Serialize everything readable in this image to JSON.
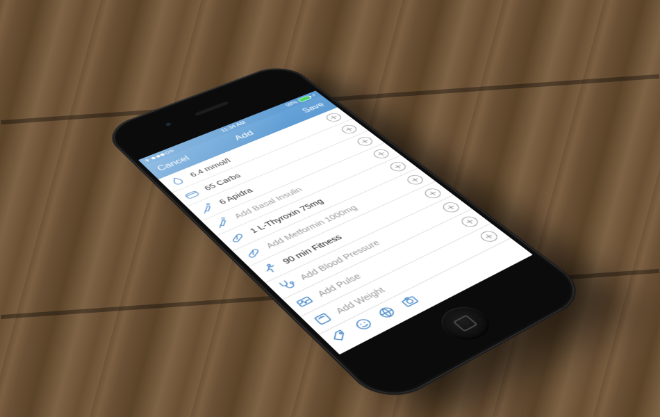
{
  "status_bar": {
    "time": "11:34 AM",
    "battery_percent": "98%",
    "airplane_mode": true
  },
  "nav": {
    "left": "Cancel",
    "title": "Add",
    "right": "Save"
  },
  "rows": [
    {
      "icon": "drop-icon",
      "label": "6.4 mmol/l",
      "placeholder": false
    },
    {
      "icon": "bread-icon",
      "label": "65 Carbs",
      "placeholder": false
    },
    {
      "icon": "syringe-icon",
      "label": "6 Apidra",
      "placeholder": false
    },
    {
      "icon": "syringe-icon",
      "label": "Add Basal Insulin",
      "placeholder": true
    },
    {
      "icon": "pill-icon",
      "label": "1 L-Thyroxin 75mg",
      "placeholder": false
    },
    {
      "icon": "pill-icon",
      "label": "Add Metformin 1000mg",
      "placeholder": true
    },
    {
      "icon": "runner-icon",
      "label": "90 min Fitness",
      "placeholder": false
    },
    {
      "icon": "stethoscope-icon",
      "label": "Add Blood Pressure",
      "placeholder": true
    },
    {
      "icon": "pulse-icon",
      "label": "Add Pulse",
      "placeholder": true
    },
    {
      "icon": "scale-icon",
      "label": "Add Weight",
      "placeholder": true
    }
  ],
  "bottom_icons": [
    {
      "name": "tag-icon"
    },
    {
      "name": "face-icon"
    },
    {
      "name": "globe-icon"
    },
    {
      "name": "camera-icon"
    }
  ],
  "colors": {
    "accent": "#5e9cd3",
    "icon": "#3f82c5",
    "placeholder": "#9a9a9a"
  }
}
